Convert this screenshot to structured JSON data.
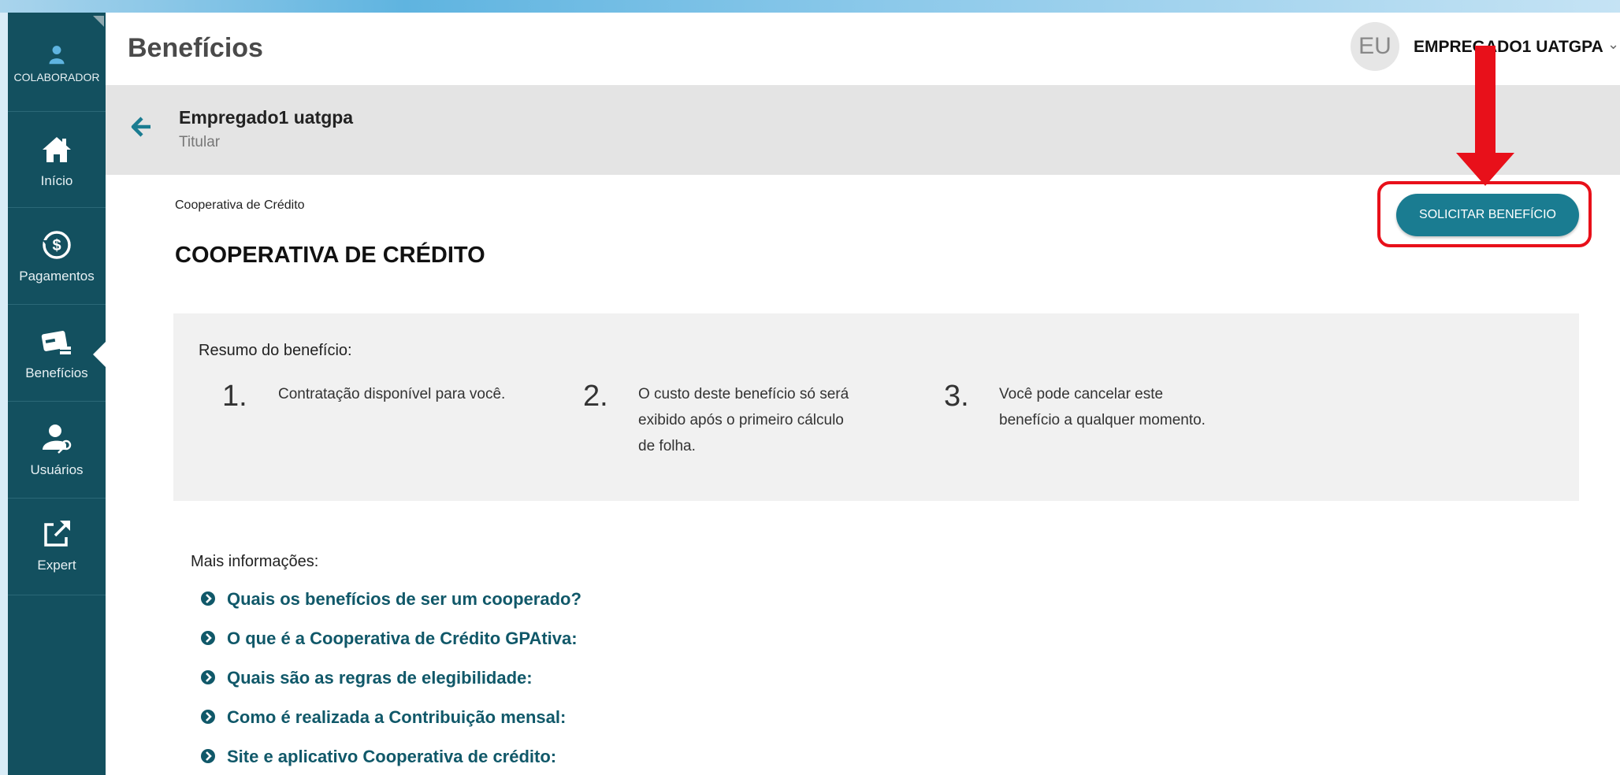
{
  "header": {
    "title": "Benefícios",
    "avatar_initials": "EU",
    "user_name": "EMPREGADO1 UATGPA",
    "chevron": "⌄"
  },
  "sidebar": {
    "items": [
      {
        "label": "COLABORADOR",
        "icon": "user-icon"
      },
      {
        "label": "Início",
        "icon": "home-icon"
      },
      {
        "label": "Pagamentos",
        "icon": "dollar-cycle-icon"
      },
      {
        "label": "Benefícios",
        "icon": "card-icon"
      },
      {
        "label": "Usuários",
        "icon": "user-key-icon"
      },
      {
        "label": "Expert",
        "icon": "external-link-icon"
      }
    ]
  },
  "employee": {
    "name": "Empregado1 uatgpa",
    "role": "Titular"
  },
  "content": {
    "breadcrumb": "Cooperativa de Crédito",
    "heading": "COOPERATIVA DE CRÉDITO",
    "request_button": "SOLICITAR BENEFÍCIO"
  },
  "summary": {
    "title": "Resumo do benefício:",
    "steps": [
      {
        "num": "1.",
        "line1": "Contratação disponível para você.",
        "line2": "",
        "line3": ""
      },
      {
        "num": "2.",
        "line1": "O custo deste benefício só será",
        "line2": "exibido após o primeiro cálculo",
        "line3": "de folha."
      },
      {
        "num": "3.",
        "line1": "Você pode cancelar este",
        "line2": "benefício a qualquer momento.",
        "line3": ""
      }
    ]
  },
  "more_info": {
    "title": "Mais informações:",
    "links": [
      "Quais os benefícios de ser um cooperado?",
      "O que é a Cooperativa de Crédito GPAtiva:",
      "Quais são as regras de elegibilidade:",
      "Como é realizada a Contribuição mensal:",
      "Site e aplicativo Cooperativa de crédito:"
    ]
  },
  "colors": {
    "sidebar": "#13505f",
    "accent": "#1a7c91",
    "link": "#105869",
    "highlight": "#e8101a"
  }
}
